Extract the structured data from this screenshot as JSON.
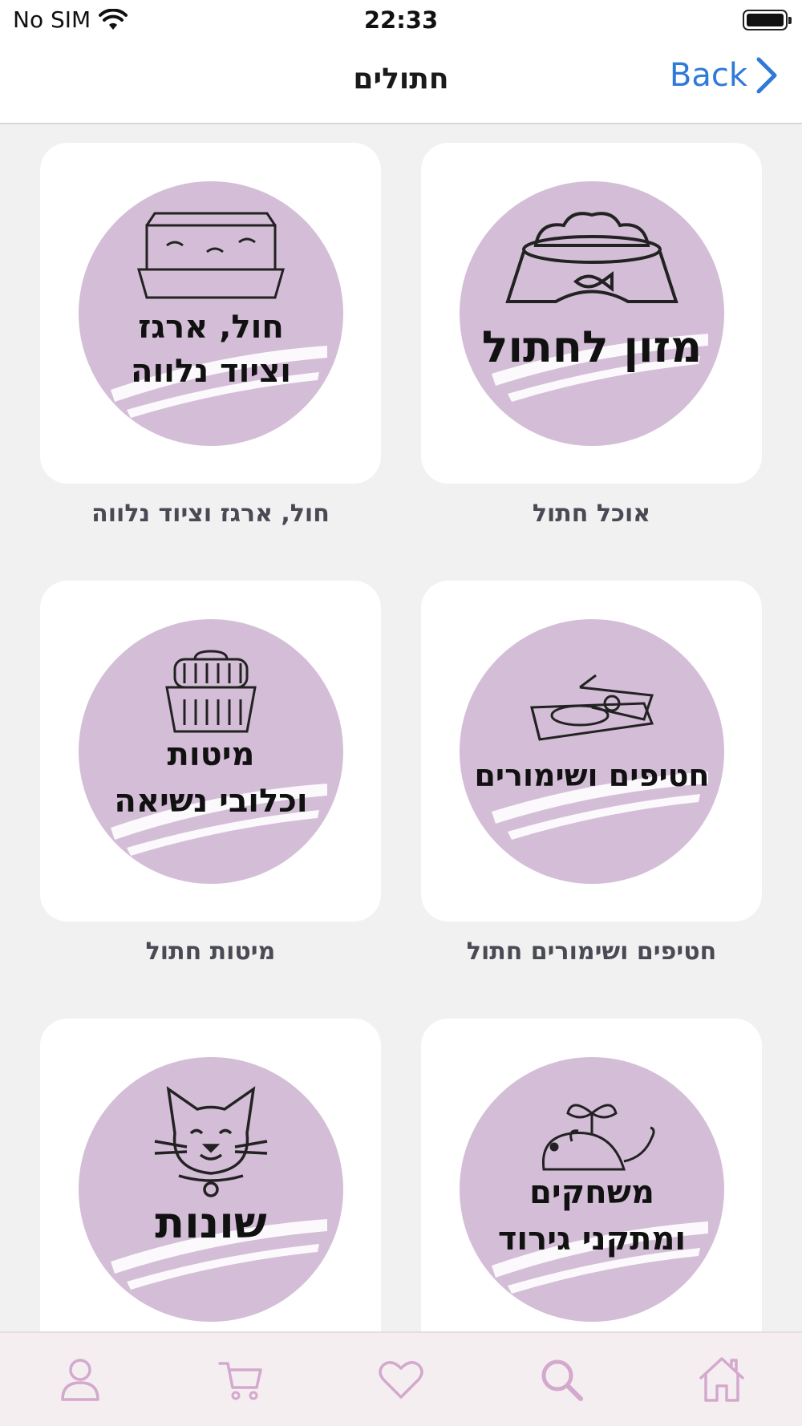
{
  "status": {
    "carrier": "No SIM",
    "time": "22:33"
  },
  "nav": {
    "title": "חתולים",
    "back_label": "Back"
  },
  "colors": {
    "accent": "#2f7ad8",
    "circle": "#d4bdd7",
    "tab_icon": "#d3a9cd"
  },
  "categories": [
    {
      "caption": "אוכל חתול",
      "art_line1": "מזון לחתול",
      "art_line2": "",
      "icon": "food-bowl-icon"
    },
    {
      "caption": "חול, ארגז וציוד נלווה",
      "art_line1": "חול, ארגז",
      "art_line2": "וציוד נלווה",
      "icon": "litter-box-icon"
    },
    {
      "caption": "חטיפים ושימורים חתול",
      "art_line1": "חטיפים ושימורים",
      "art_line2": "",
      "icon": "sardine-can-icon"
    },
    {
      "caption": "מיטות חתול",
      "art_line1": "מיטות",
      "art_line2": "וכלובי נשיאה",
      "icon": "pet-carrier-icon"
    },
    {
      "caption": "",
      "art_line1": "משחקים",
      "art_line2": "ומתקני גירוד",
      "icon": "toy-mouse-icon"
    },
    {
      "caption": "",
      "art_line1": "שונות",
      "art_line2": "",
      "icon": "cat-face-icon"
    }
  ],
  "tabs": [
    {
      "name": "profile",
      "icon": "user-icon"
    },
    {
      "name": "cart",
      "icon": "cart-icon"
    },
    {
      "name": "favorites",
      "icon": "heart-icon"
    },
    {
      "name": "search",
      "icon": "search-icon"
    },
    {
      "name": "home",
      "icon": "home-icon"
    }
  ]
}
